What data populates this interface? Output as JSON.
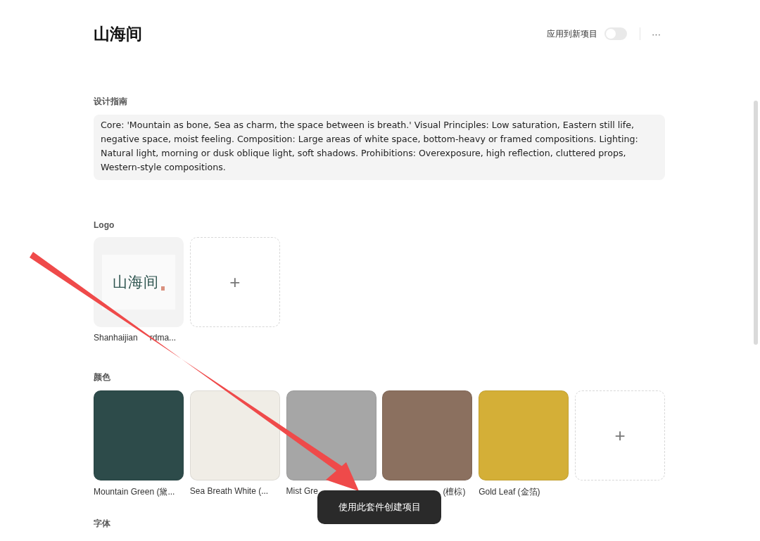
{
  "header": {
    "title": "山海间",
    "apply_label": "应用到新项目",
    "apply_toggle": {
      "on": false
    },
    "more": "···"
  },
  "guide": {
    "heading": "设计指南",
    "text": "Core: 'Mountain as bone, Sea as charm, the space between is breath.' Visual Principles: Low saturation, Eastern still life, negative space, moist feeling. Composition: Large areas of white space, bottom-heavy or framed compositions. Lighting: Natural light, morning or dusk oblique light, soft shadows. Prohibitions: Overexposure, high reflection, cluttered props, Western-style compositions."
  },
  "logo": {
    "heading": "Logo",
    "items": [
      {
        "kind": "logo",
        "mark": "山海间",
        "caption": "Shanhaijian",
        "caption_tail": "rdma..."
      },
      {
        "kind": "add",
        "symbol": "+"
      }
    ]
  },
  "colors": {
    "heading": "颜色",
    "items": [
      {
        "kind": "swatch",
        "color": "#2d4b4a",
        "caption": "Mountain Green (黛..."
      },
      {
        "kind": "swatch",
        "color": "#f0ede6",
        "caption": "Sea Breath White (..."
      },
      {
        "kind": "swatch",
        "color": "#a6a6a6",
        "caption": "Mist Gre"
      },
      {
        "kind": "swatch",
        "color": "#8b705f",
        "caption_tail": "(檀棕)"
      },
      {
        "kind": "swatch",
        "color": "#d4af37",
        "caption": "Gold Leaf (金箔)"
      },
      {
        "kind": "add",
        "symbol": "+"
      }
    ]
  },
  "fonts": {
    "heading": "字体"
  },
  "toast": {
    "text": "使用此套件创建项目"
  }
}
